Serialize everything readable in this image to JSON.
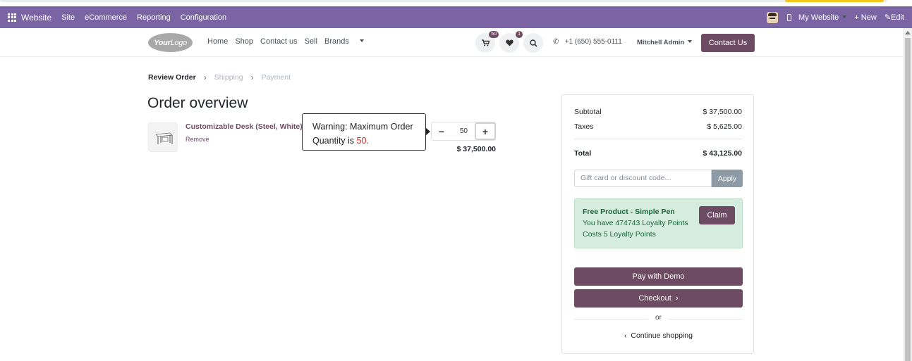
{
  "admin_bar": {
    "app_name": "Website",
    "menus": [
      "Site",
      "eCommerce",
      "Reporting",
      "Configuration"
    ],
    "my_website": "My Website",
    "new": "+ New",
    "edit": "Edit"
  },
  "header": {
    "logo_bold": "Your",
    "logo_light": "Logo",
    "nav": [
      "Home",
      "Shop",
      "Contact us",
      "Sell",
      "Brands"
    ],
    "cart_count": "50",
    "wishlist_count": "1",
    "phone": "+1 (650) 555-0111",
    "user": "Mitchell Admin",
    "contact_button": "Contact Us"
  },
  "checkout_steps": {
    "current": "Review Order",
    "step2": "Shipping",
    "step3": "Payment"
  },
  "order": {
    "title": "Order overview",
    "product_name": "Customizable Desk (Steel, White)",
    "remove": "Remove",
    "quantity": "50",
    "line_price": "$ 37,500.00"
  },
  "warning": {
    "text": "Warning: Maximum Order Quantity is",
    "limit": "50."
  },
  "summary": {
    "subtotal_label": "Subtotal",
    "subtotal": "$ 37,500.00",
    "taxes_label": "Taxes",
    "taxes": "$ 5,625.00",
    "total_label": "Total",
    "total": "$ 43,125.00",
    "coupon_placeholder": "Gift card or discount code...",
    "apply": "Apply",
    "reward_title": "Free Product - Simple Pen",
    "reward_points": "You have 474743 Loyalty Points",
    "reward_cost": "Costs 5 Loyalty Points",
    "claim": "Claim",
    "pay_demo": "Pay with Demo",
    "checkout": "Checkout",
    "or": "or",
    "continue": "Continue shopping"
  }
}
